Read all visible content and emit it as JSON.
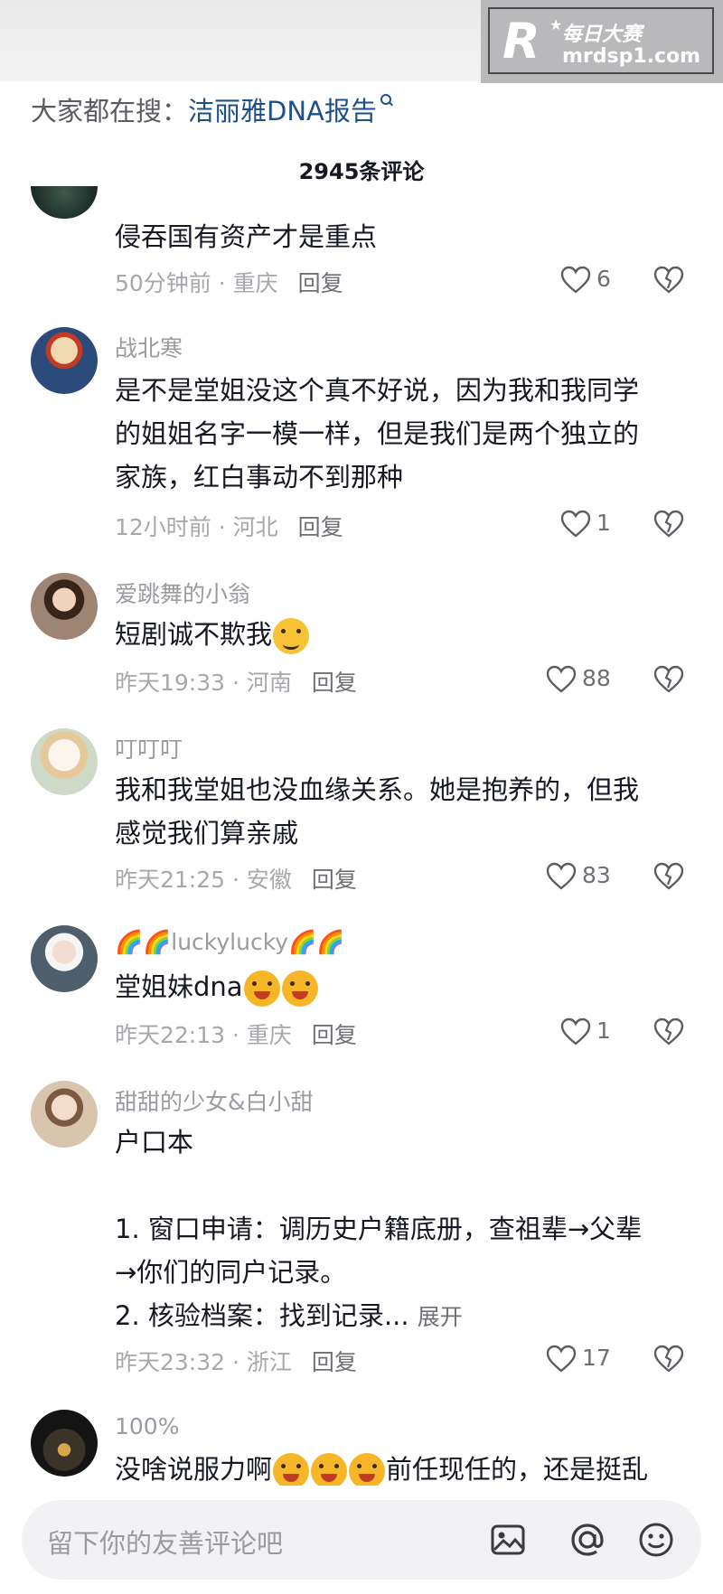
{
  "watermark": {
    "logo_letter": "R",
    "cn": "每日大赛",
    "url": "mrdsp1.com"
  },
  "search": {
    "prefix": "大家都在搜：",
    "term": "洁丽雅DNA报告"
  },
  "comments_title": "2945条评论",
  "comments": [
    {
      "username": "",
      "text": [
        "侵吞国有资产才是重点"
      ],
      "time": "50分钟前",
      "location": "重庆",
      "reply": "回复",
      "likes": "6",
      "avatar_color": "#1b2a2e"
    },
    {
      "username": "战北寒",
      "text": [
        "是不是堂姐没这个真不好说，因为我和我同学",
        "的姐姐名字一模一样，但是我们是两个独立的",
        "家族，红白事动不到那种"
      ],
      "time": "12小时前",
      "location": "河北",
      "reply": "回复",
      "likes": "1",
      "avatar_color": "#2c4a7a"
    },
    {
      "username": "爱跳舞的小翁",
      "text": [
        "短剧诚不欺我"
      ],
      "time": "昨天19:33",
      "location": "河南",
      "reply": "回复",
      "likes": "88",
      "avatar_color": "#8a6e5a"
    },
    {
      "username": "叮叮叮",
      "text": [
        "我和我堂姐也没血缘关系。她是抱养的，但我",
        "感觉我们算亲戚"
      ],
      "time": "昨天21:25",
      "location": "安徽",
      "reply": "回复",
      "likes": "83",
      "avatar_color": "#d9c9a8"
    },
    {
      "username": "🌈🌈luckylucky🌈🌈",
      "text": [
        "堂姐妹dna"
      ],
      "time": "昨天22:13",
      "location": "重庆",
      "reply": "回复",
      "likes": "1",
      "avatar_color": "#7a8a96"
    },
    {
      "username": "甜甜的少女&白小甜",
      "text": [
        "户口本",
        "",
        "1. 窗口申请：调历史户籍底册，查祖辈→父辈",
        "→你们的同户记录。",
        "2. 核验档案：找到记录..."
      ],
      "expand": "展开",
      "time": "昨天23:32",
      "location": "浙江",
      "reply": "回复",
      "likes": "17",
      "avatar_color": "#c9a98a"
    },
    {
      "username": "100%",
      "text": [
        "没啥说服力啊",
        "前任现任的，还是挺乱"
      ],
      "avatar_color": "#3a3328"
    }
  ],
  "input": {
    "placeholder": "留下你的友善评论吧"
  }
}
